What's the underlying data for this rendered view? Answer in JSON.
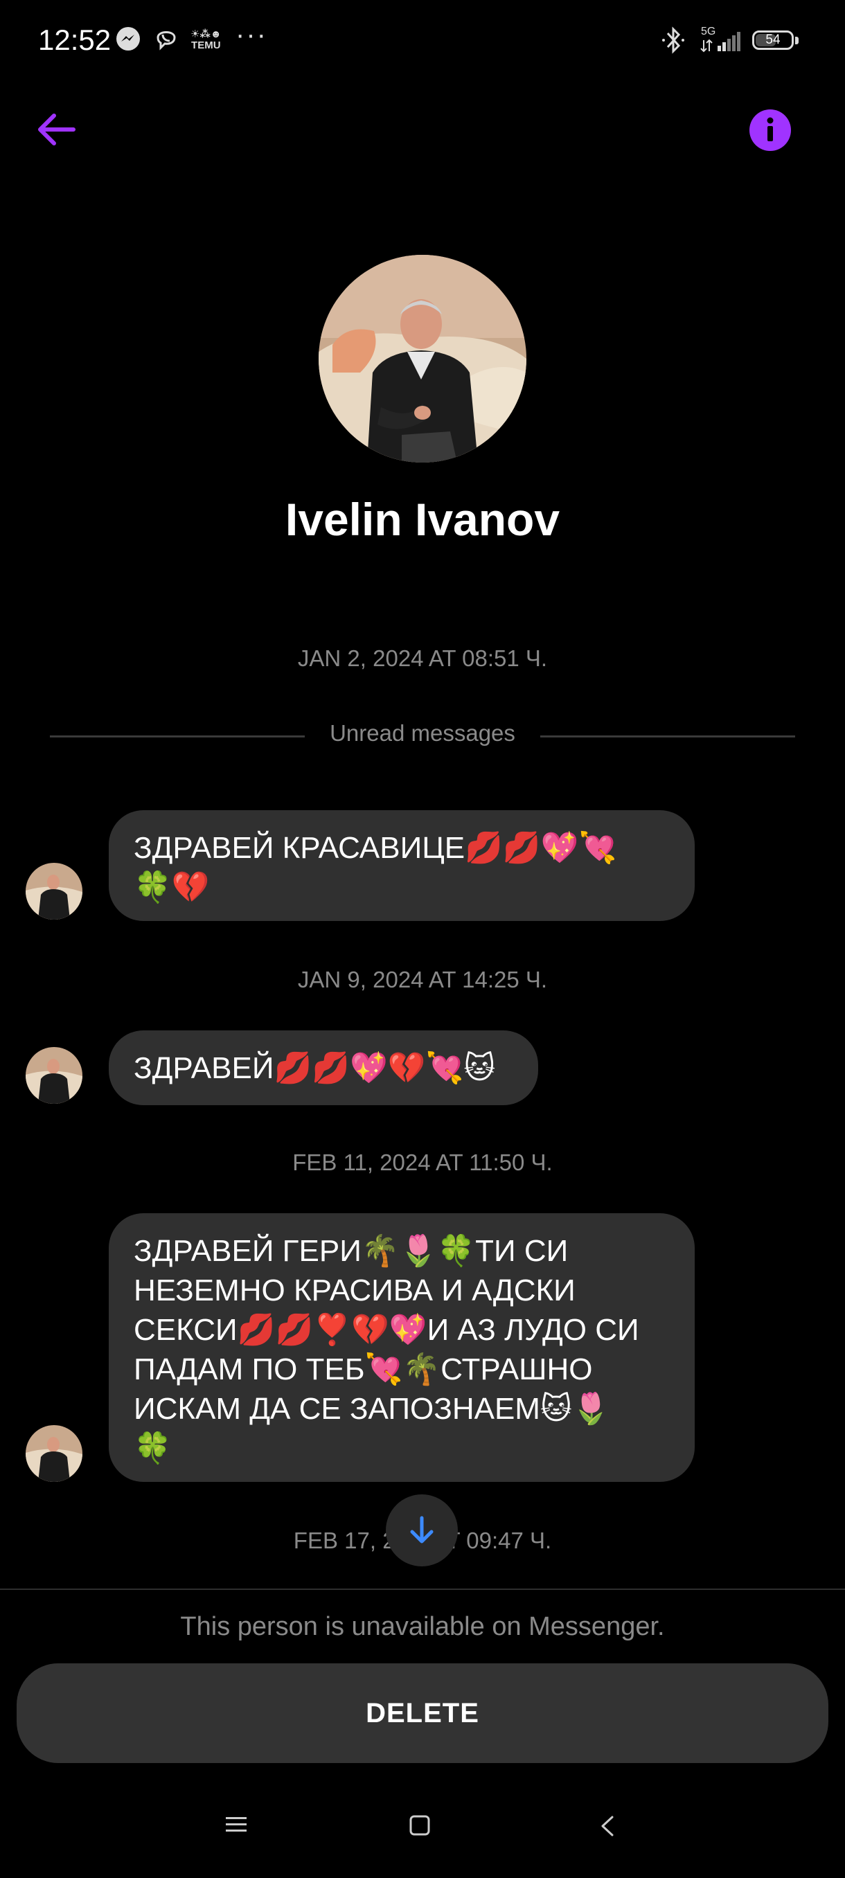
{
  "status_bar": {
    "time": "12:52",
    "icons": [
      "messenger-icon",
      "viber-icon",
      "temu-icon",
      "more-dots-icon",
      "bluetooth-icon",
      "signal-5g-icon"
    ],
    "temu_label": "TEMU",
    "dots": "···",
    "network": "5G",
    "battery": "54"
  },
  "header": {
    "back_icon": "arrow-left-icon",
    "info_icon": "info-icon",
    "accent_color": "#a033ff"
  },
  "profile": {
    "name": "Ivelin Ivanov"
  },
  "conversation": {
    "timestamp_1": "JAN 2, 2024 AT 08:51 Ч.",
    "unread_label": "Unread messages",
    "message_1": "ЗДРАВЕЙ КРАСАВИЦЕ💋💋💖💘\n🍀💔",
    "timestamp_2": "JAN 9, 2024 AT 14:25 Ч.",
    "message_2": "ЗДРАВЕЙ💋💋💖💔💘🐱",
    "timestamp_3": "FEB 11, 2024 AT 11:50 Ч.",
    "message_3": "ЗДРАВЕЙ ГЕРИ🌴🌷🍀ТИ СИ НЕЗЕМНО КРАСИВА И АДСКИ СЕКСИ💋💋❣️💔💖И АЗ ЛУДО СИ ПАДАМ ПО ТЕБ💘🌴СТРАШНО ИСКАМ ДА СЕ ЗАПОЗНАЕМ🐱🌷\n🍀",
    "timestamp_4_visible": "FEB 17, 2",
    "timestamp_4_tail": "T 09:47 Ч."
  },
  "footer": {
    "unavailable_text": "This person is unavailable on Messenger.",
    "delete_label": "DELETE"
  },
  "nav_bar": {
    "icons": [
      "menu-icon",
      "home-square-icon",
      "back-chevron-icon"
    ]
  }
}
